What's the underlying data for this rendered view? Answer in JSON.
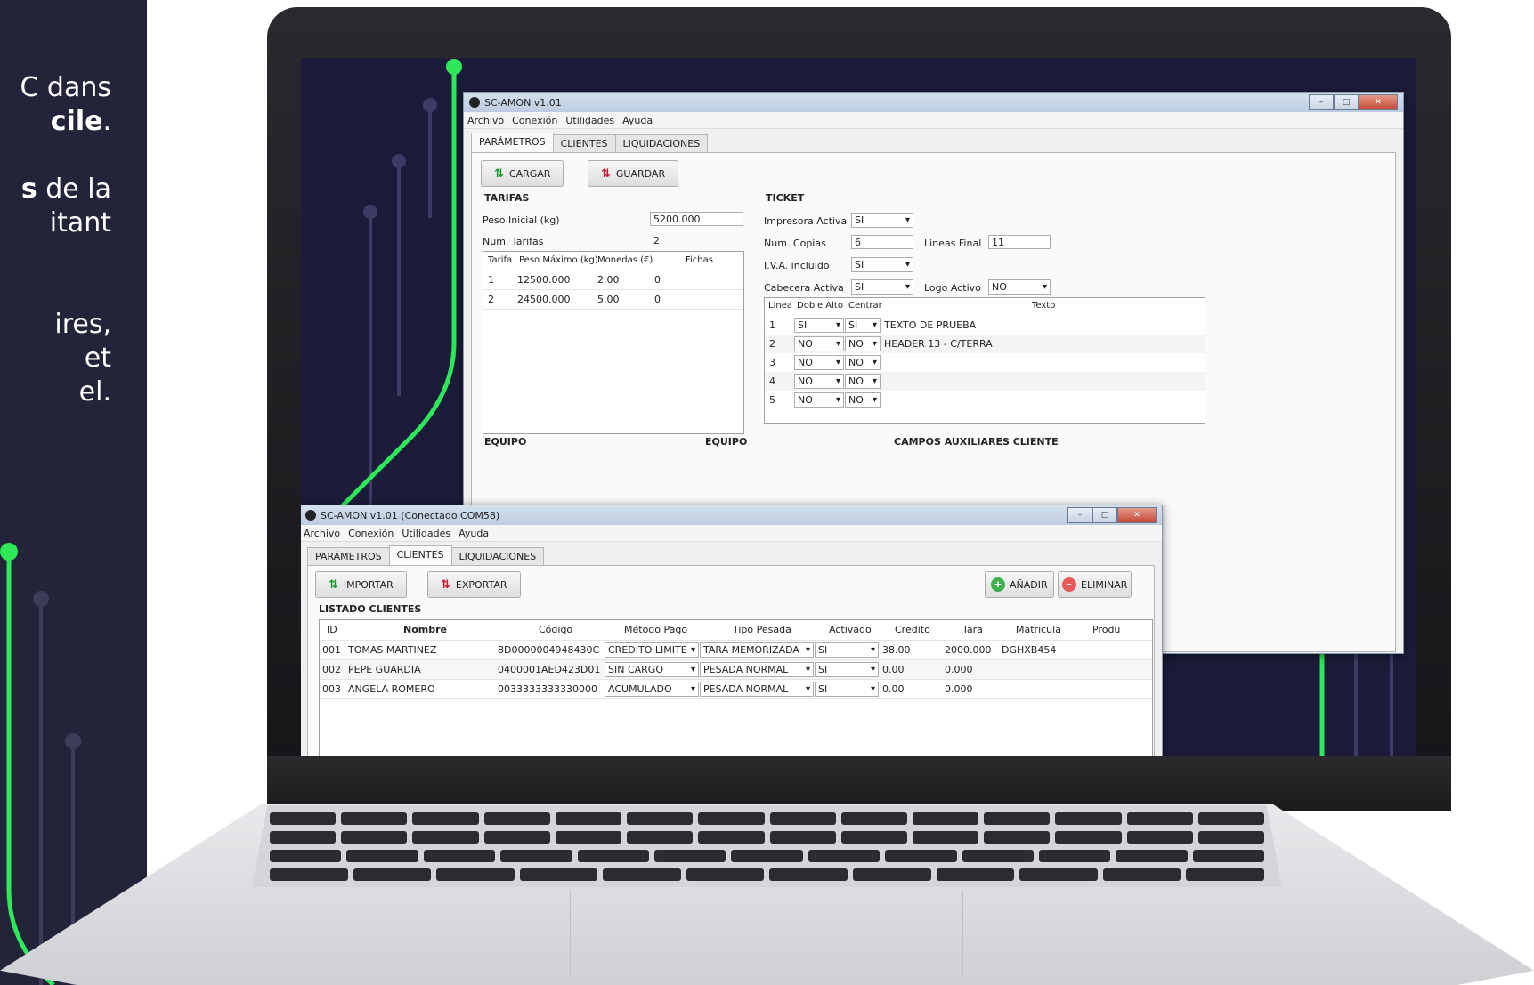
{
  "side": {
    "line1": "C dans",
    "line2": "cile",
    "line2_suffix": ".",
    "line3": "s",
    "line3_suffix": " de la",
    "line4": "itant",
    "line5": "ires,",
    "line6": "et",
    "line7": "el."
  },
  "win1": {
    "title": "SC-AMON v1.01",
    "menu": [
      "Archivo",
      "Conexión",
      "Utilidades",
      "Ayuda"
    ],
    "tabs": [
      "PARÁMETROS",
      "CLIENTES",
      "LIQUIDACIONES"
    ],
    "btn_cargar": "CARGAR",
    "btn_guardar": "GUARDAR",
    "tarifas": {
      "title": "TARIFAS",
      "peso_inicial_label": "Peso Inicial (kg)",
      "peso_inicial_value": "5200.000",
      "num_tarifas_label": "Num. Tarifas",
      "num_tarifas_value": "2",
      "headers": [
        "Tarifa",
        "Peso Máximo (kg)",
        "Monedas (€)",
        "Fichas"
      ],
      "rows": [
        [
          "1",
          "12500.000",
          "2.00",
          "0"
        ],
        [
          "2",
          "24500.000",
          "5.00",
          "0"
        ]
      ]
    },
    "ticket": {
      "title": "TICKET",
      "impresora_label": "Impresora Activa",
      "impresora_value": "SI",
      "copias_label": "Num. Copias",
      "copias_value": "6",
      "lineas_final_label": "Lineas Final",
      "lineas_final_value": "11",
      "iva_label": "I.V.A. incluido",
      "iva_value": "SI",
      "cabecera_label": "Cabecera Activa",
      "cabecera_value": "SI",
      "logo_label": "Logo Activo",
      "logo_value": "NO",
      "headers": [
        "Linea",
        "Doble Alto",
        "Centrar",
        "Texto"
      ],
      "rows": [
        [
          "1",
          "SI",
          "SI",
          "TEXTO DE PRUEBA"
        ],
        [
          "2",
          "NO",
          "NO",
          "HEADER 13 - C/TERRA"
        ],
        [
          "3",
          "NO",
          "NO",
          ""
        ],
        [
          "4",
          "NO",
          "NO",
          ""
        ],
        [
          "5",
          "NO",
          "NO",
          ""
        ]
      ]
    },
    "equipo1": "EQUIPO",
    "equipo2": "EQUIPO",
    "campos": "CAMPOS AUXILIARES CLIENTE"
  },
  "win2": {
    "title": "SC-AMON v1.01 (Conectado COM58)",
    "menu": [
      "Archivo",
      "Conexión",
      "Utilidades",
      "Ayuda"
    ],
    "tabs": [
      "PARÁMETROS",
      "CLIENTES",
      "LIQUIDACIONES"
    ],
    "btn_importar": "IMPORTAR",
    "btn_exportar": "EXPORTAR",
    "btn_anadir": "AÑADIR",
    "btn_eliminar": "ELIMINAR",
    "listado": "LISTADO CLIENTES",
    "headers": [
      "ID",
      "Nombre",
      "Código",
      "Método Pago",
      "Tipo Pesada",
      "Activado",
      "Credito",
      "Tara",
      "Matricula",
      "Produ"
    ],
    "rows": [
      [
        "001",
        "TOMAS MARTINEZ",
        "8D0000004948430C",
        "CREDITO LIMITE",
        "TARA MEMORIZADA",
        "SI",
        "38.00",
        "2000.000",
        "DGHXB454"
      ],
      [
        "002",
        "PEPE GUARDIA",
        "0400001AED423D01",
        "SIN CARGO",
        "PESADA NORMAL",
        "SI",
        "0.00",
        "0.000",
        ""
      ],
      [
        "003",
        "ANGELA ROMERO",
        "0033333333330000",
        "ACUMULADO",
        "PESADA NORMAL",
        "SI",
        "0.00",
        "0.000",
        ""
      ]
    ]
  }
}
